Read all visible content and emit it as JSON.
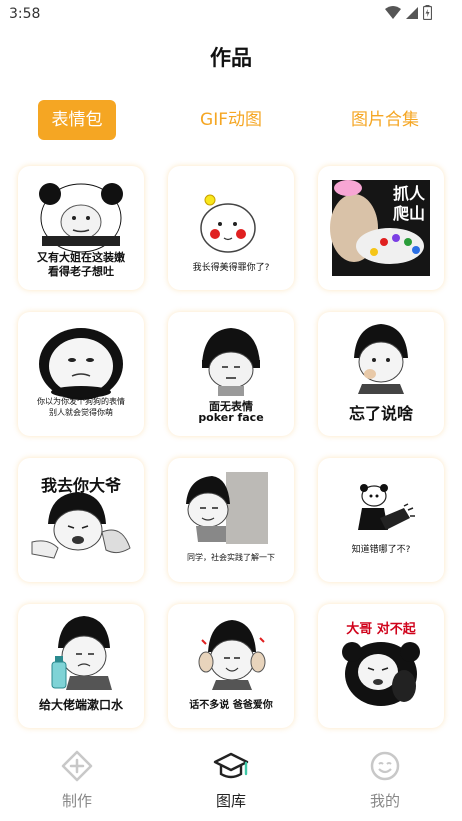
{
  "status_bar": {
    "time": "3:58"
  },
  "header": {
    "title": "作品"
  },
  "tabs": [
    {
      "label": "表情包",
      "active": true
    },
    {
      "label": "GIF动图",
      "active": false
    },
    {
      "label": "图片合集",
      "active": false
    }
  ],
  "stickers": [
    {
      "caption_lines": [
        "又有大姐在这装嫩",
        "看得老子想吐"
      ]
    },
    {
      "caption_lines": [
        "我长得美得罪你了?"
      ]
    },
    {
      "caption_lines": [
        "抓人",
        "爬山"
      ]
    },
    {
      "caption_lines": [
        "你以为你发个狗狗的表情",
        "别人就会觉得你萌"
      ]
    },
    {
      "caption_lines": [
        "面无表情",
        "poker face"
      ]
    },
    {
      "caption_lines": [
        "忘了说啥"
      ]
    },
    {
      "caption_lines": [
        "我去你大爷"
      ]
    },
    {
      "caption_lines": [
        "同学，社会实践了解一下"
      ]
    },
    {
      "caption_lines": [
        "知道错哪了不?"
      ]
    },
    {
      "caption_lines": [
        "给大佬端漱口水"
      ]
    },
    {
      "caption_lines": [
        "话不多说 爸爸爱你"
      ]
    },
    {
      "caption_lines": [
        "大哥 对不起"
      ]
    }
  ],
  "bottom_nav": [
    {
      "label": "制作",
      "icon": "plus-diamond-icon",
      "active": false
    },
    {
      "label": "图库",
      "icon": "graduation-cap-icon",
      "active": true
    },
    {
      "label": "我的",
      "icon": "smiley-face-icon",
      "active": false
    }
  ],
  "colors": {
    "accent": "#f5a623",
    "inactive": "#888888",
    "active_text": "#222222"
  }
}
